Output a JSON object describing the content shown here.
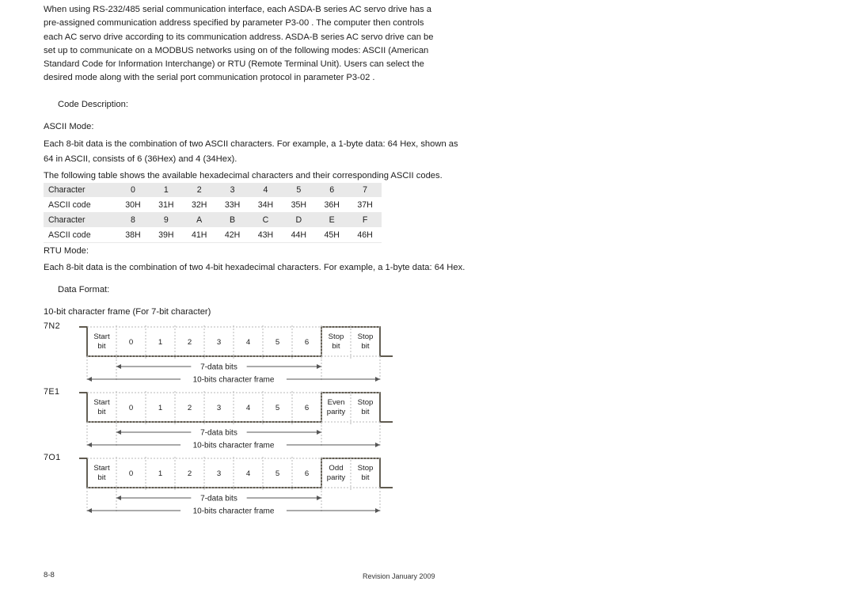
{
  "document": {
    "intro_paragraph": "When using RS-232/485 serial communication interface, each ASDA-B series AC servo drive has a pre-assigned communication address specified by parameter  P3-00 . The computer then controls each AC servo drive according to its communication address. ASDA-B series AC servo drive can be set up to communicate on a MODBUS networks using on of the following modes: ASCII (American Standard Code for Information Interchange) or RTU (Remote Terminal Unit). Users can select the desired mode along with the serial port communication protocol in parameter  P3-02 .",
    "code_description_heading": "Code Description:",
    "ascii_mode_heading": "ASCII Mode:",
    "ascii_mode_line1": "Each 8-bit data is the combination of two ASCII characters. For example, a 1-byte data: 64 Hex, shown as",
    "ascii_mode_line2": " 64  in ASCII, consists of  6  (36Hex) and  4   (34Hex).",
    "table_intro": "The following table shows the available hexadecimal characters and their corresponding ASCII codes.",
    "rtu_mode_heading": "RTU Mode:",
    "rtu_mode_line1": "Each 8-bit data is the combination of two 4-bit hexadecimal characters. For example, a 1-byte data: 64 Hex.",
    "data_format_heading": "Data Format:",
    "frame_intro": "10-bit character frame (For 7-bit character)"
  },
  "ascii_table": {
    "row_headers": [
      "Character",
      "ASCII code",
      "Character",
      "ASCII code"
    ],
    "rows": [
      {
        "label": "Character",
        "shaded": true,
        "cells": [
          "0",
          "1",
          "2",
          "3",
          "4",
          "5",
          "6",
          "7"
        ]
      },
      {
        "label": "ASCII code",
        "shaded": false,
        "cells": [
          "30H",
          "31H",
          "32H",
          "33H",
          "34H",
          "35H",
          "36H",
          "37H"
        ]
      },
      {
        "label": "Character",
        "shaded": true,
        "cells": [
          "8",
          "9",
          "A",
          "B",
          "C",
          "D",
          "E",
          "F"
        ]
      },
      {
        "label": "ASCII code",
        "shaded": false,
        "cells": [
          "38H",
          "39H",
          "41H",
          "42H",
          "43H",
          "44H",
          "45H",
          "46H"
        ]
      }
    ]
  },
  "frames": [
    {
      "name": "7N2",
      "cells": [
        {
          "line1": "Start",
          "line2": "bit"
        },
        {
          "line1": "0",
          "line2": ""
        },
        {
          "line1": "1",
          "line2": ""
        },
        {
          "line1": "2",
          "line2": ""
        },
        {
          "line1": "3",
          "line2": ""
        },
        {
          "line1": "4",
          "line2": ""
        },
        {
          "line1": "5",
          "line2": ""
        },
        {
          "line1": "6",
          "line2": ""
        },
        {
          "line1": "Stop",
          "line2": "bit"
        },
        {
          "line1": "Stop",
          "line2": "bit"
        }
      ],
      "data_bits_label": "7-data bits",
      "character_frame_label": "10-bits character frame"
    },
    {
      "name": "7E1",
      "cells": [
        {
          "line1": "Start",
          "line2": "bit"
        },
        {
          "line1": "0",
          "line2": ""
        },
        {
          "line1": "1",
          "line2": ""
        },
        {
          "line1": "2",
          "line2": ""
        },
        {
          "line1": "3",
          "line2": ""
        },
        {
          "line1": "4",
          "line2": ""
        },
        {
          "line1": "5",
          "line2": ""
        },
        {
          "line1": "6",
          "line2": ""
        },
        {
          "line1": "Even",
          "line2": "parity"
        },
        {
          "line1": "Stop",
          "line2": "bit"
        }
      ],
      "data_bits_label": "7-data bits",
      "character_frame_label": "10-bits character frame"
    },
    {
      "name": "7O1",
      "cells": [
        {
          "line1": "Start",
          "line2": "bit"
        },
        {
          "line1": "0",
          "line2": ""
        },
        {
          "line1": "1",
          "line2": ""
        },
        {
          "line1": "2",
          "line2": ""
        },
        {
          "line1": "3",
          "line2": ""
        },
        {
          "line1": "4",
          "line2": ""
        },
        {
          "line1": "5",
          "line2": ""
        },
        {
          "line1": "6",
          "line2": ""
        },
        {
          "line1": "Odd",
          "line2": "parity"
        },
        {
          "line1": "Stop",
          "line2": "bit"
        }
      ],
      "data_bits_label": "7-data bits",
      "character_frame_label": "10-bits character frame"
    }
  ],
  "footer": {
    "page_number": "8-8",
    "revision": "Revision January 2009"
  },
  "colors": {
    "text": "#1d1d1d",
    "table_shaded": "#e9e9e9",
    "waveform": "#4a4438",
    "grid_dotted": "#b9b9b9",
    "arrow": "#555555"
  }
}
